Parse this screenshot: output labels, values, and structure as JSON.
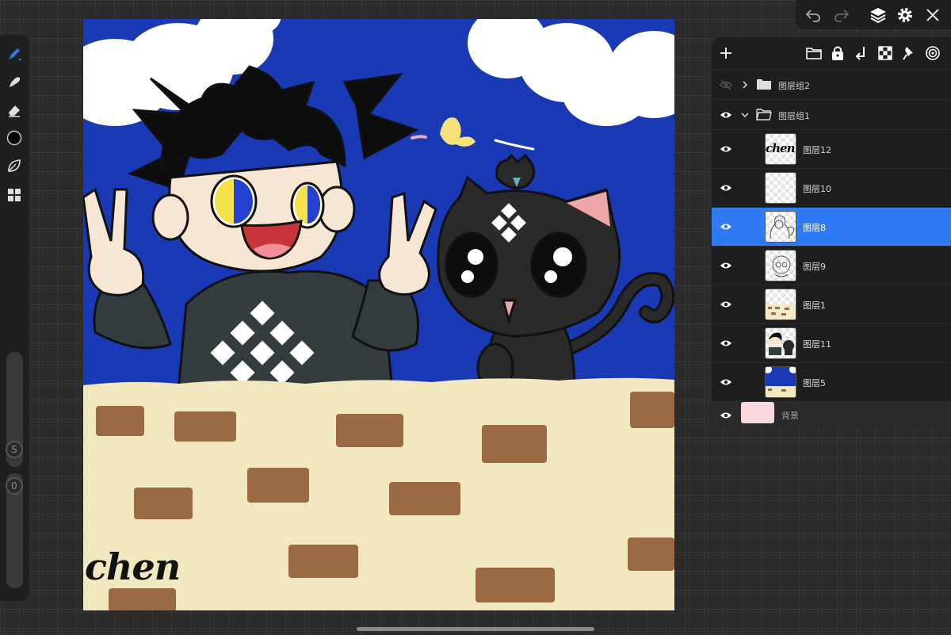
{
  "canvas": {
    "signature": "chen",
    "colors": {
      "sky": "#1a39b4",
      "wall": "#f2e8bf",
      "brick": "#9b6a43",
      "cloud": "#ffffff",
      "outline": "#111111"
    }
  },
  "left_toolbar": {
    "tools": [
      "brush-icon",
      "smudge-icon",
      "eraser-icon",
      "color-swatch",
      "leaf-icon",
      "grid-icon"
    ],
    "size_knob_label": "S",
    "opacity_knob_label": "0"
  },
  "top_toolbar": {
    "icons": [
      "undo-icon",
      "redo-icon",
      "layers-icon",
      "gear-icon",
      "close-icon"
    ]
  },
  "layers": {
    "accent": "#2f7af5",
    "header_icons": [
      "plus-icon",
      "folder-icon",
      "lock-icon",
      "merge-down-icon",
      "checker-icon",
      "pin-icon",
      "target-icon"
    ],
    "groups": [
      {
        "label": "图层组2",
        "expanded": false,
        "visible": false
      },
      {
        "label": "图层组1",
        "expanded": true,
        "visible": true
      }
    ],
    "items": [
      {
        "label": "图层12",
        "thumb_text": "chen"
      },
      {
        "label": "图层10"
      },
      {
        "label": "图层8",
        "selected": true
      },
      {
        "label": "图层9"
      },
      {
        "label": "图层1"
      },
      {
        "label": "图层11"
      },
      {
        "label": "图层5"
      }
    ],
    "background": {
      "label": "背景",
      "color": "#f8d8dc"
    }
  }
}
